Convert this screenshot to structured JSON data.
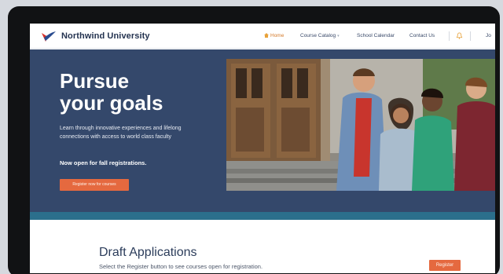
{
  "header": {
    "brand": "Northwind University",
    "nav": {
      "home": "Home",
      "course_catalog": "Course Catalog",
      "school_calendar": "School Calendar",
      "contact_us": "Contact Us",
      "user": "Jo"
    }
  },
  "hero": {
    "title_line1": "Pursue",
    "title_line2": "your goals",
    "description": "Learn through innovative experiences and lifelong connections with access to world class faculty",
    "open_notice": "Now open for fall registrations.",
    "cta_label": "Register now for courses"
  },
  "draft": {
    "title": "Draft Applications",
    "description": "Select the Register button to see courses open for registration.",
    "register_label": "Register"
  },
  "colors": {
    "hero_bg": "#34486b",
    "accent": "#e5693f",
    "stripe": "#2b6f8c",
    "brand_text": "#23324f"
  },
  "icons": {
    "logo": "bird-logo-icon",
    "home": "home-icon",
    "notifications": "bell-icon",
    "dropdown": "chevron-down-icon"
  }
}
